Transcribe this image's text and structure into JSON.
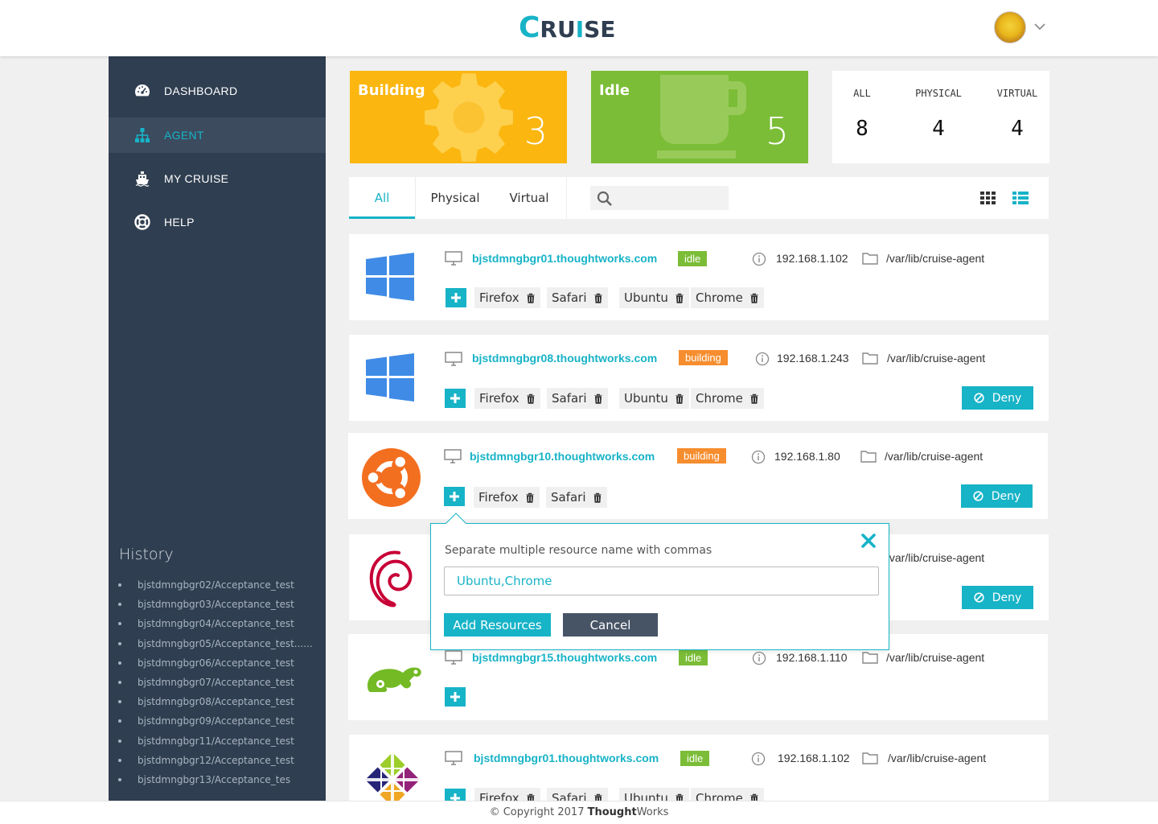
{
  "header": {
    "logo_big_c": "C",
    "logo_ru": "RU",
    "logo_i": "I",
    "logo_se": "SE",
    "avatar_icon": "user-avatar",
    "caret_icon": "chevron-down-icon"
  },
  "sidebar": {
    "items": [
      {
        "label": "DASHBOARD",
        "icon": "dashboard-icon"
      },
      {
        "label": "AGENT",
        "icon": "sitemap-icon"
      },
      {
        "label": "MY CRUISE",
        "icon": "ship-icon"
      },
      {
        "label": "HELP",
        "icon": "life-ring-icon"
      }
    ],
    "history_title": "History",
    "history": [
      "bjstdmngbgr02/Acceptance_test",
      "bjstdmngbgr03/Acceptance_test",
      "bjstdmngbgr04/Acceptance_test",
      "bjstdmngbgr05/Acceptance_test......",
      "bjstdmngbgr06/Acceptance_test",
      "bjstdmngbgr07/Acceptance_test",
      "bjstdmngbgr08/Acceptance_test",
      "bjstdmngbgr09/Acceptance_test",
      "bjstdmngbgr11/Acceptance_test",
      "bjstdmngbgr12/Acceptance_test",
      "bjstdmngbgr13/Acceptance_tes"
    ]
  },
  "cards": {
    "building": {
      "label": "Building",
      "count": "3",
      "color": "#fbb60f"
    },
    "idle": {
      "label": "Idle",
      "count": "5",
      "color": "#7bbd36"
    }
  },
  "stats": [
    {
      "label": "ALL",
      "value": "8"
    },
    {
      "label": "PHYSICAL",
      "value": "4"
    },
    {
      "label": "VIRTUAL",
      "value": "4"
    }
  ],
  "tabs": [
    "All",
    "Physical",
    "Virtual"
  ],
  "search": {
    "placeholder": "",
    "value": ""
  },
  "agents": [
    {
      "os": "windows",
      "host": "bjstdmngbgr01.thoughtworks.com",
      "status": "idle",
      "ip": "192.168.1.102",
      "path": "/var/lib/cruise-agent",
      "resources": [
        "Firefox",
        "Safari",
        "Ubuntu",
        "Chrome"
      ],
      "deny": ""
    },
    {
      "os": "windows",
      "host": "bjstdmngbgr08.thoughtworks.com",
      "status": "building",
      "ip": "192.168.1.243",
      "path": "/var/lib/cruise-agent",
      "resources": [
        "Firefox",
        "Safari",
        "Ubuntu",
        "Chrome"
      ],
      "deny": "Deny"
    },
    {
      "os": "ubuntu",
      "host": "bjstdmngbgr10.thoughtworks.com",
      "status": "building",
      "ip": "192.168.1.80",
      "path": "/var/lib/cruise-agent",
      "resources": [
        "Firefox",
        "Safari"
      ],
      "deny": "Deny"
    },
    {
      "os": "debian",
      "host": "",
      "status": "",
      "ip": "",
      "path": "/var/lib/cruise-agent",
      "resources": [],
      "deny": "Deny"
    },
    {
      "os": "opensuse",
      "host": "bjstdmngbgr15.thoughtworks.com",
      "status": "idle",
      "ip": "192.168.1.110",
      "path": "/var/lib/cruise-agent",
      "resources": [],
      "deny": ""
    },
    {
      "os": "centos",
      "host": "bjstdmngbgr01.thoughtworks.com",
      "status": "idle",
      "ip": "192.168.1.102",
      "path": "/var/lib/cruise-agent",
      "resources": [
        "Firefox",
        "Safari",
        "Ubuntu",
        "Chrome"
      ],
      "deny": ""
    }
  ],
  "popover": {
    "hint": "Separate multiple resource name with commas",
    "value": "Ubuntu,Chrome",
    "add_label": "Add Resources",
    "cancel_label": "Cancel"
  },
  "footer": {
    "copyright": "© Copyright 2017 ",
    "brand_bold": "Thought",
    "brand_rest": "Works"
  },
  "colors": {
    "accent": "#17b3c7",
    "sidebar": "#2f3e50",
    "building": "#f68d2e",
    "idle": "#7bbd36"
  }
}
